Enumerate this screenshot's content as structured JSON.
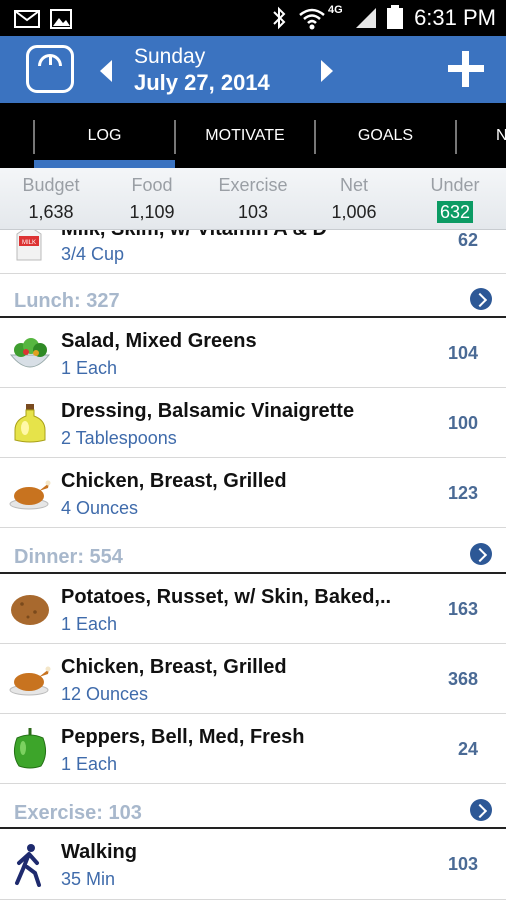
{
  "status": {
    "time": "6:31 PM",
    "network": "4G",
    "icons": [
      "mail-icon",
      "image-icon",
      "bluetooth-icon",
      "wifi-icon",
      "signal-icon",
      "battery-icon"
    ]
  },
  "header": {
    "day": "Sunday",
    "date": "July 27, 2014",
    "icons": [
      "scale-icon",
      "chevron-left-icon",
      "chevron-right-icon",
      "plus-icon"
    ]
  },
  "tabs": [
    {
      "label": "LOG",
      "active": true
    },
    {
      "label": "MOTIVATE",
      "active": false
    },
    {
      "label": "GOALS",
      "active": false
    },
    {
      "label": "N",
      "active": false
    }
  ],
  "summary": {
    "budget_label": "Budget",
    "budget": "1,638",
    "food_label": "Food",
    "food": "1,109",
    "exercise_label": "Exercise",
    "exercise": "103",
    "net_label": "Net",
    "net": "1,006",
    "under_label": "Under",
    "under": "632",
    "under_color": "#0c9b64"
  },
  "items": {
    "milk": {
      "name": "Milk, Skim, w/ Vitamin A & D",
      "qty": "3/4 Cup",
      "cal": "62",
      "icon": "milk-carton-icon"
    },
    "lunch_title": "Lunch: 327",
    "salad": {
      "name": "Salad, Mixed Greens",
      "qty": "1 Each",
      "cal": "104",
      "icon": "salad-bowl-icon"
    },
    "dressing": {
      "name": "Dressing, Balsamic Vinaigrette",
      "qty": "2 Tablespoons",
      "cal": "100",
      "icon": "oil-bottle-icon"
    },
    "chicken1": {
      "name": "Chicken, Breast, Grilled",
      "qty": "4 Ounces",
      "cal": "123",
      "icon": "roast-chicken-icon"
    },
    "dinner_title": "Dinner: 554",
    "potatoes": {
      "name": "Potatoes, Russet, w/ Skin, Baked,..",
      "qty": "1 Each",
      "cal": "163",
      "icon": "potato-icon"
    },
    "chicken2": {
      "name": "Chicken, Breast, Grilled",
      "qty": "12 Ounces",
      "cal": "368",
      "icon": "roast-chicken-icon"
    },
    "peppers": {
      "name": "Peppers, Bell, Med, Fresh",
      "qty": "1 Each",
      "cal": "24",
      "icon": "bell-pepper-icon"
    },
    "exercise_title": "Exercise: 103",
    "walking": {
      "name": "Walking",
      "qty": "35 Min",
      "cal": "103",
      "icon": "walking-person-icon"
    }
  },
  "colors": {
    "header_blue": "#3b73c0",
    "section_title": "#a8b8cc",
    "quantity_blue": "#3f6bab",
    "calorie_blue": "#4a6a95"
  }
}
